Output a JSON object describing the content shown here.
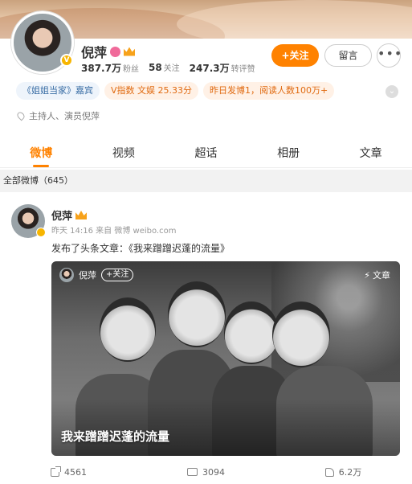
{
  "profile": {
    "name": "倪萍",
    "stats": {
      "fans_value": "387.7万",
      "fans_label": "粉丝",
      "follow_value": "58",
      "follow_label": "关注",
      "likes_value": "247.3万",
      "likes_label": "转评赞"
    },
    "follow_button": "+关注",
    "message_button": "留言",
    "more_button": "•••",
    "tags": [
      "《姐姐当家》嘉宾",
      "V指数 文娱 25.33分",
      "昨日发博1，阅读人数100万+"
    ],
    "bio": "主持人、演员倪萍"
  },
  "tabs": [
    "微博",
    "视频",
    "超话",
    "相册",
    "文章"
  ],
  "active_tab": "微博",
  "section_title": "全部微博（645）",
  "post": {
    "author": "倪萍",
    "meta": "昨天 14:16  来自 微博 weibo.com",
    "text": "发布了头条文章：《我来蹭蹭迟蓬的流量》",
    "card": {
      "author": "倪萍",
      "follow_label": "+关注",
      "type_label": "文章",
      "title": "我来蹭蹭迟蓬的流量"
    },
    "actions": {
      "share_count": "4561",
      "comment_count": "3094",
      "like_count": "6.2万"
    }
  },
  "colors": {
    "accent": "#ff8200",
    "tag_blue": "#3a6ea5",
    "tag_orange": "#e06a10"
  }
}
